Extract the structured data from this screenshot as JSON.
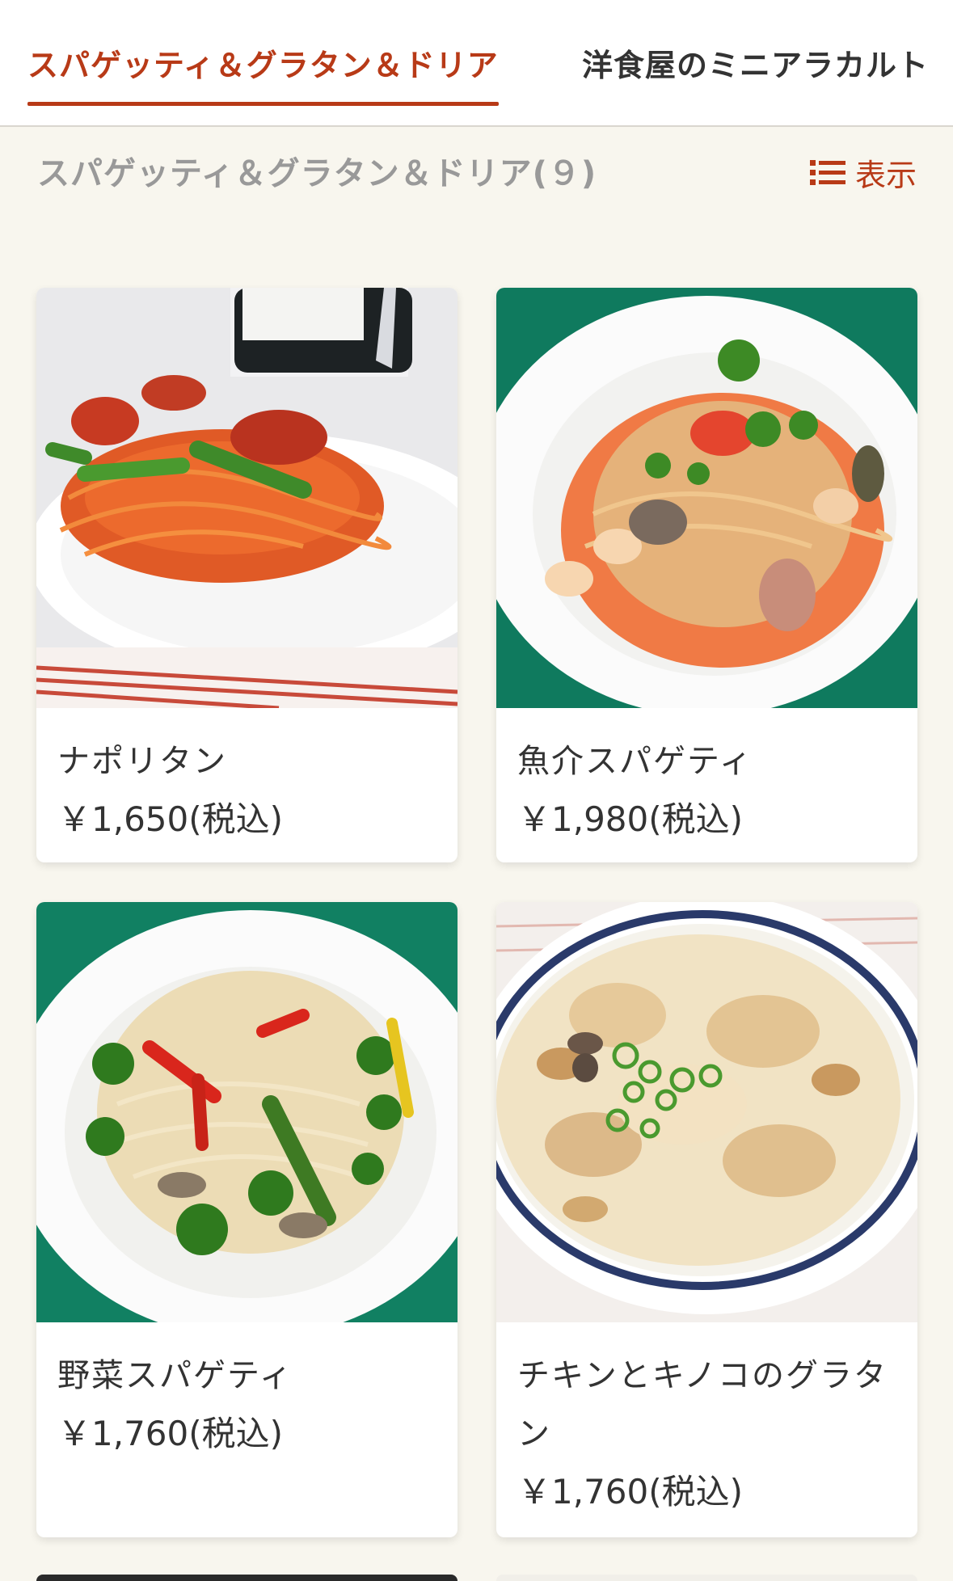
{
  "tabs": [
    {
      "label": "スパゲッティ＆グラタン＆ドリア",
      "active": true
    },
    {
      "label": "洋食屋のミニアラカルト",
      "active": false
    }
  ],
  "section": {
    "title": "スパゲッティ＆グラタン＆ドリア(９)",
    "display_label": "表示",
    "display_icon": "list-icon"
  },
  "items": [
    {
      "name": "ナポリタン",
      "price": "￥1,650(税込)"
    },
    {
      "name": "魚介スパゲティ",
      "price": "￥1,980(税込)"
    },
    {
      "name": "野菜スパゲティ",
      "price": "￥1,760(税込)"
    },
    {
      "name": "チキンとキノコのグラタン",
      "price": "￥1,760(税込)"
    }
  ],
  "colors": {
    "accent": "#b83a17",
    "background": "#f8f6ee",
    "card": "#ffffff"
  }
}
